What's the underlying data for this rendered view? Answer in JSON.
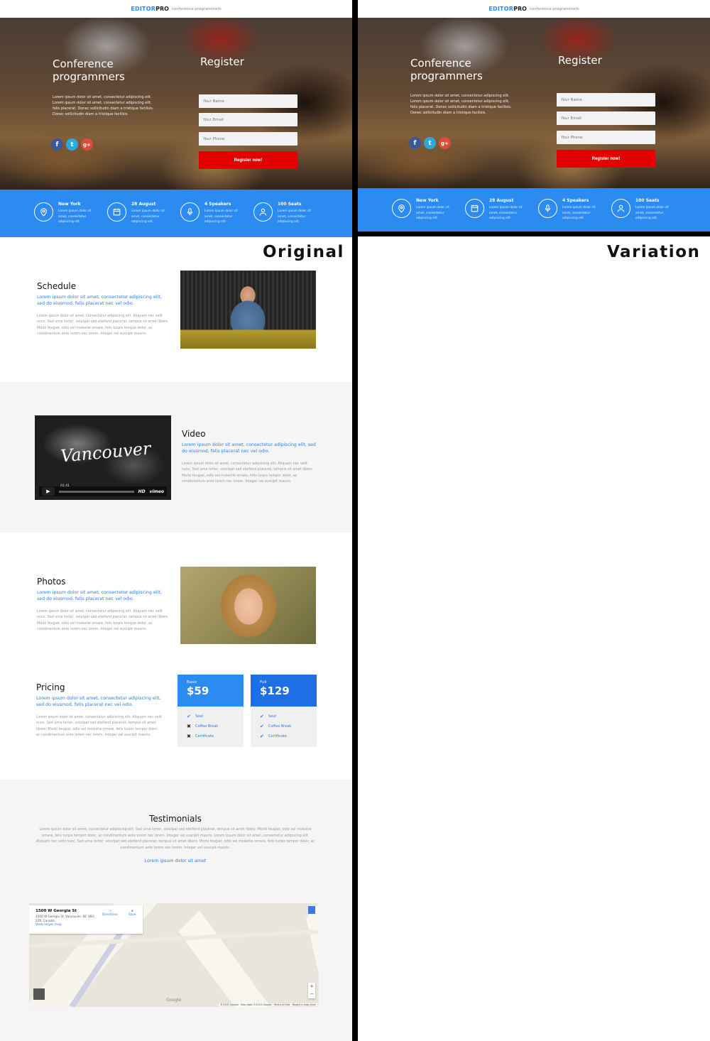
{
  "brand": {
    "name_a": "EDITOR",
    "name_b": "PRO",
    "tagline": "conference programmers"
  },
  "hero": {
    "title": "Conference programmers",
    "text": "Lorem ipsum dolor sit amet, consectetur adipiscing elit. Lorem ipsum dolor sit amet, consectetur adipiscing elit, felis placerat. Donec sollicitudin diam a tristique facilisis. Donec sollicitudin diam a tristique facilisis.",
    "social": {
      "facebook": "f",
      "twitter": "t",
      "google_plus": "g+"
    }
  },
  "register": {
    "title": "Register",
    "name_placeholder": "Your Name",
    "email_placeholder": "Your Email",
    "phone_placeholder": "Your Phone",
    "button": "Register now!"
  },
  "info": [
    {
      "title": "New York",
      "desc": "Lorem ipsum dolor sit amet, consectetur adipiscing elit.",
      "icon": "location-pin-icon"
    },
    {
      "title": "28 August",
      "desc": "Lorem ipsum dolor sit amet, consectetur adipiscing elit.",
      "icon": "calendar-icon"
    },
    {
      "title": "4 Speakers",
      "desc": "Lorem ipsum dolor sit amet, consectetur adipiscing elit.",
      "icon": "microphone-icon"
    },
    {
      "title": "100 Seats",
      "desc": "Lorem ipsum dolor sit amet, consectetur adipiscing elit.",
      "icon": "user-icon"
    }
  ],
  "labels": {
    "original": "Original",
    "variation": "Variation"
  },
  "schedule": {
    "title": "Schedule",
    "lead": "Lorem ipsum dolor sit amet, consectetur adipiscing elit, sed do eiusmod, felis placerat nec vel odio.",
    "body": "Lorem ipsum dolor sit amet, consectetur adipiscing elit. Aliquam nec velit nunc. Sed urna tortor, volutpat sed eleifend placerat, tempus sit amet libero. Morbi feugiat, odio vel molestie ornare, felis turpis tempor dolor, ac condimentum ante lorem nec lorem. Integer vel suscipit mauris."
  },
  "video": {
    "title": "Video",
    "lead": "Lorem ipsum dolor sit amet, consectetur adipiscing elit, sed do eiusmod, felis placerat nec vel odio.",
    "body": "Lorem ipsum dolor sit amet, consectetur adipiscing elit. Aliquam nec velit nunc. Sed urna tortor, volutpat sed eleifend placerat, tempus sit amet libero. Morbi feugiat, odio vel molestie ornare, felis turpis tempor dolor, ac condimentum ante lorem nec lorem. Integer vel suscipit mauris.",
    "player_title": "Vancouver",
    "time": "01:41",
    "hd": "HD",
    "provider": "vimeo"
  },
  "photos": {
    "title": "Photos",
    "lead": "Lorem ipsum dolor sit amet, consectetur adipiscing elit, sed do eiusmod, felis placerat nec vel odio.",
    "body": "Lorem ipsum dolor sit amet, consectetur adipiscing elit. Aliquam nec velit nunc. Sed urna tortor, volutpat sed eleifend placerat, tempus sit amet libero. Morbi feugiat, odio vel molestie ornare, felis turpis tempor dolor, ac condimentum ante lorem nec lorem. Integer vel suscipit mauris."
  },
  "pricing": {
    "title": "Pricing",
    "lead": "Lorem ipsum dolor sit amet, consectetur adipiscing elit, sed do eiusmod, felis placerat nec vel odio.",
    "body": "Lorem ipsum dolor sit amet, consectetur adipiscing elit. Aliquam nec velit nunc. Sed urna tortor, volutpat sed eleifend placerat, tempus sit amet libero. Morbi feugiat, odio vel molestie ornare, felis turpis tempor dolor, ac condimentum ante lorem nec lorem. Integer vel suscipit mauris.",
    "plans": [
      {
        "name": "Basic",
        "price": "$59",
        "color": "#2b8bf1",
        "features": [
          {
            "label": "Seat",
            "included": true
          },
          {
            "label": "Coffee Break",
            "included": false
          },
          {
            "label": "Certificate",
            "included": false
          }
        ]
      },
      {
        "name": "Full",
        "price": "$129",
        "color": "#1e6fe6",
        "features": [
          {
            "label": "Seat",
            "included": true
          },
          {
            "label": "Coffee Break",
            "included": true
          },
          {
            "label": "Certificate",
            "included": true
          }
        ]
      }
    ]
  },
  "testimonials": {
    "title": "Testimonials",
    "body": "Lorem ipsum dolor sit amet, consectetur adipiscing elit. Sed urna tortor, volutpat sed eleifend placerat, tempus sit amet libero. Morbi feugiat, odio vel molestie ornare, felis turpis tempor dolor, ac condimentum ante lorem nec lorem. Integer vel suscipit mauris. Lorem ipsum dolor sit amet, consectetur adipiscing elit. Aliquam nec velit nunc. Sed urna tortor, volutpat sed eleifend placerat, tempus sit amet libero. Morbi feugiat, odio vel molestie ornare, felis turpis tempor dolor, ac condimentum ante lorem nec lorem. Integer vel suscipit mauris.",
    "author": "Lorem ipsum dolor sit amet"
  },
  "map": {
    "address": "1500 W Georgia St",
    "full_address": "1500 W Georgia St, Vancouver, BC V6G 2Z6, Canada",
    "larger_link": "View larger map",
    "directions": "Directions",
    "save": "Save",
    "google": "Google",
    "footer": "©2015 Google · Map data ©2015 Google · Terms of Use · Report a map error"
  }
}
